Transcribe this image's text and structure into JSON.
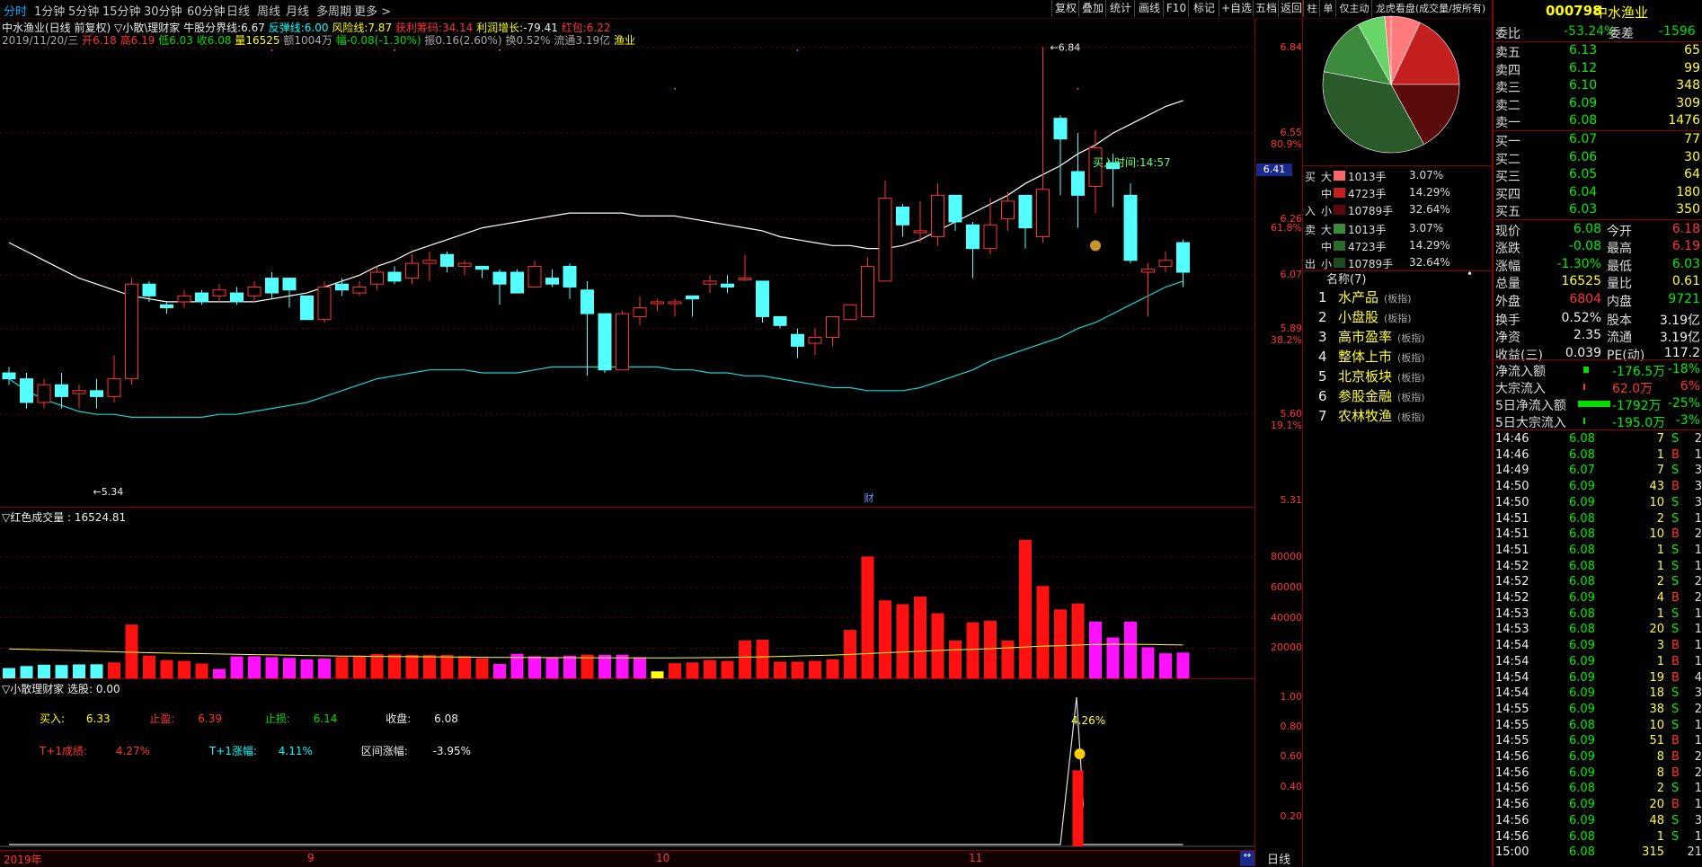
{
  "toolbar": {
    "periods": [
      "分时",
      "1分钟",
      "5分钟",
      "15分钟",
      "30分钟",
      "60分钟",
      "日线",
      "周线",
      "月线",
      "多周期",
      "更多 >"
    ],
    "actions": [
      "复权",
      "叠加",
      "统计",
      "画线",
      "F10",
      "标记",
      "+自选",
      "五档",
      "返回"
    ],
    "right_tabs": [
      "柱",
      "单",
      "仅主动",
      "龙虎看盘(成交量/按所有)"
    ]
  },
  "info1": {
    "stock": "中水渔业(日线 前复权)",
    "indicator": "▽小散\\理财家",
    "nk_label": "牛股分界线:",
    "nk_val": "6.67",
    "ft_label": "反弹线:",
    "ft_val": "6.00",
    "fx_label": "风险线:",
    "fx_val": "7.87",
    "hl_label": "获利筹码:",
    "hl_val": "34.14",
    "lr_label": "利润增长:",
    "lr_val": "-79.41",
    "hb_label": "红包:",
    "hb_val": "6.22"
  },
  "info2": {
    "date": "2019/11/20/三",
    "open_l": "开",
    "open": "6.18",
    "high_l": "高",
    "high": "6.19",
    "low_l": "低",
    "low": "6.03",
    "close_l": "收",
    "close": "6.08",
    "vol_l": "量",
    "vol": "16525",
    "amt": "额1004万",
    "chg": "幅-0.08(-1.30%)",
    "amp": "振0.16(2.60%)",
    "turn": "换0.52%",
    "float": "流通3.19亿",
    "sector": "渔业"
  },
  "main_chart": {
    "price_axis": [
      "6.84",
      "6.55",
      "6.26",
      "6.07",
      "5.89",
      "5.60",
      "5.31"
    ],
    "pct_axis": [
      "80.9%",
      "61.8%",
      "38.2%",
      "19.1%"
    ],
    "current_price_tag": "6.41",
    "high_marker": "6.84",
    "low_marker": "5.34",
    "buy_time": "买入时间:14:57",
    "cai_marker": "财"
  },
  "vol_panel": {
    "title": "▽红色成交量 : 16524.81",
    "axis": [
      "80000",
      "60000",
      "40000",
      "20000"
    ]
  },
  "sig_panel": {
    "title": "▽小散理财家  选股: 0.00",
    "buy_l": "买入:",
    "buy": "6.33",
    "tp_l": "止盈:",
    "tp": "6.39",
    "sl_l": "止损:",
    "sl": "6.14",
    "close_l": "收盘:",
    "close": "6.08",
    "t1_l": "T+1成绩:",
    "t1": "4.27%",
    "t1z_l": "T+1涨幅:",
    "t1z": "4.11%",
    "qj_l": "区间涨幅:",
    "qj": "-3.95%",
    "axis": [
      "1.00",
      "0.80",
      "0.60",
      "0.40",
      "0.20"
    ],
    "peak_label": "4.26%"
  },
  "date_axis": {
    "labels": [
      "2019年",
      "9",
      "10",
      "11"
    ],
    "period": "日线"
  },
  "flow_panel": {
    "rows": [
      {
        "side": "买",
        "size": "大",
        "vol": "1013手",
        "pct": "3.07%"
      },
      {
        "side": "",
        "size": "中",
        "vol": "4723手",
        "pct": "14.29%"
      },
      {
        "side": "入",
        "size": "小",
        "vol": "10789手",
        "pct": "32.64%"
      },
      {
        "side": "卖",
        "size": "大",
        "vol": "1013手",
        "pct": "3.07%"
      },
      {
        "side": "",
        "size": "中",
        "vol": "4723手",
        "pct": "14.29%"
      },
      {
        "side": "出",
        "size": "小",
        "vol": "10789手",
        "pct": "32.64%"
      }
    ]
  },
  "sectors": {
    "header": "名称(7)",
    "items": [
      {
        "idx": "1",
        "name": "水产品",
        "tag": "(板指)"
      },
      {
        "idx": "2",
        "name": "小盘股",
        "tag": "(板指)"
      },
      {
        "idx": "3",
        "name": "高市盈率",
        "tag": "(板指)"
      },
      {
        "idx": "4",
        "name": "整体上市",
        "tag": "(板指)"
      },
      {
        "idx": "5",
        "name": "北京板块",
        "tag": "(板指)"
      },
      {
        "idx": "6",
        "name": "参股金融",
        "tag": "(板指)"
      },
      {
        "idx": "7",
        "name": "农林牧渔",
        "tag": "(板指)"
      }
    ]
  },
  "quote": {
    "code": "000798",
    "name": "中水渔业",
    "weibi_l": "委比",
    "weibi": "-53.24%",
    "weicha_l": "委差",
    "weicha": "-1596",
    "asks": [
      {
        "label": "卖五",
        "price": "6.13",
        "vol": "65"
      },
      {
        "label": "卖四",
        "price": "6.12",
        "vol": "99"
      },
      {
        "label": "卖三",
        "price": "6.10",
        "vol": "348"
      },
      {
        "label": "卖二",
        "price": "6.09",
        "vol": "309"
      },
      {
        "label": "卖一",
        "price": "6.08",
        "vol": "1476"
      }
    ],
    "bids": [
      {
        "label": "买一",
        "price": "6.07",
        "vol": "77"
      },
      {
        "label": "买二",
        "price": "6.06",
        "vol": "30"
      },
      {
        "label": "买三",
        "price": "6.05",
        "vol": "64"
      },
      {
        "label": "买四",
        "price": "6.04",
        "vol": "180"
      },
      {
        "label": "买五",
        "price": "6.03",
        "vol": "350"
      }
    ],
    "stats": [
      {
        "l1": "现价",
        "v1": "6.08",
        "c1": "green",
        "l2": "今开",
        "v2": "6.18",
        "c2": "red"
      },
      {
        "l1": "涨跌",
        "v1": "-0.08",
        "c1": "green",
        "l2": "最高",
        "v2": "6.19",
        "c2": "red"
      },
      {
        "l1": "涨幅",
        "v1": "-1.30%",
        "c1": "green",
        "l2": "最低",
        "v2": "6.03",
        "c2": "green"
      },
      {
        "l1": "总量",
        "v1": "16525",
        "c1": "yellow",
        "l2": "量比",
        "v2": "0.61",
        "c2": "yellow"
      },
      {
        "l1": "外盘",
        "v1": "6804",
        "c1": "red",
        "l2": "内盘",
        "v2": "9721",
        "c2": "green"
      },
      {
        "l1": "换手",
        "v1": "0.52%",
        "c1": "white",
        "l2": "股本",
        "v2": "3.19亿",
        "c2": "white"
      },
      {
        "l1": "净资",
        "v1": "2.35",
        "c1": "white",
        "l2": "流通",
        "v2": "3.19亿",
        "c2": "white"
      },
      {
        "l1": "收益(三)",
        "v1": "0.039",
        "c1": "white",
        "l2": "PE(动)",
        "v2": "117.2",
        "c2": "white"
      }
    ],
    "flows": [
      {
        "label": "净流入额",
        "value": "-176.5万",
        "pct": "-18%"
      },
      {
        "label": "大宗流入",
        "value": "62.0万",
        "pct": "6%"
      },
      {
        "label": "5日净流入额",
        "value": "-1792万",
        "pct": "-25%"
      },
      {
        "label": "5日大宗流入",
        "value": "-195.0万",
        "pct": "-3%"
      }
    ]
  },
  "ticks": [
    {
      "t": "14:46",
      "p": "6.08",
      "v": "7",
      "d": "S",
      "n": "2"
    },
    {
      "t": "14:46",
      "p": "6.08",
      "v": "1",
      "d": "B",
      "n": "1"
    },
    {
      "t": "14:49",
      "p": "6.07",
      "v": "7",
      "d": "S",
      "n": "3"
    },
    {
      "t": "14:50",
      "p": "6.09",
      "v": "43",
      "d": "B",
      "n": "3"
    },
    {
      "t": "14:50",
      "p": "6.09",
      "v": "10",
      "d": "S",
      "n": "3"
    },
    {
      "t": "14:51",
      "p": "6.08",
      "v": "2",
      "d": "S",
      "n": "1"
    },
    {
      "t": "14:51",
      "p": "6.08",
      "v": "10",
      "d": "B",
      "n": "2"
    },
    {
      "t": "14:51",
      "p": "6.08",
      "v": "1",
      "d": "S",
      "n": "1"
    },
    {
      "t": "14:52",
      "p": "6.08",
      "v": "1",
      "d": "S",
      "n": "1"
    },
    {
      "t": "14:52",
      "p": "6.08",
      "v": "2",
      "d": "S",
      "n": "2"
    },
    {
      "t": "14:52",
      "p": "6.09",
      "v": "4",
      "d": "B",
      "n": "2"
    },
    {
      "t": "14:53",
      "p": "6.08",
      "v": "1",
      "d": "S",
      "n": "1"
    },
    {
      "t": "14:53",
      "p": "6.08",
      "v": "20",
      "d": "S",
      "n": "1"
    },
    {
      "t": "14:54",
      "p": "6.09",
      "v": "3",
      "d": "B",
      "n": "1"
    },
    {
      "t": "14:54",
      "p": "6.09",
      "v": "1",
      "d": "B",
      "n": "1"
    },
    {
      "t": "14:54",
      "p": "6.09",
      "v": "19",
      "d": "B",
      "n": "4"
    },
    {
      "t": "14:54",
      "p": "6.09",
      "v": "18",
      "d": "S",
      "n": "3"
    },
    {
      "t": "14:55",
      "p": "6.09",
      "v": "38",
      "d": "S",
      "n": "2"
    },
    {
      "t": "14:55",
      "p": "6.08",
      "v": "10",
      "d": "S",
      "n": "1"
    },
    {
      "t": "14:55",
      "p": "6.09",
      "v": "51",
      "d": "B",
      "n": "1"
    },
    {
      "t": "14:56",
      "p": "6.09",
      "v": "8",
      "d": "B",
      "n": "2"
    },
    {
      "t": "14:56",
      "p": "6.09",
      "v": "8",
      "d": "B",
      "n": "2"
    },
    {
      "t": "14:56",
      "p": "6.08",
      "v": "2",
      "d": "S",
      "n": "1"
    },
    {
      "t": "14:56",
      "p": "6.09",
      "v": "20",
      "d": "B",
      "n": "1"
    },
    {
      "t": "14:56",
      "p": "6.09",
      "v": "48",
      "d": "S",
      "n": "3"
    },
    {
      "t": "14:56",
      "p": "6.08",
      "v": "1",
      "d": "S",
      "n": "1"
    },
    {
      "t": "15:00",
      "p": "6.08",
      "v": "315",
      "d": "",
      "n": "21"
    }
  ],
  "candles": [
    [
      5.74,
      5.72,
      5.76,
      5.7
    ],
    [
      5.72,
      5.64,
      5.74,
      5.62
    ],
    [
      5.64,
      5.7,
      5.72,
      5.62
    ],
    [
      5.7,
      5.66,
      5.74,
      5.62
    ],
    [
      5.67,
      5.68,
      5.7,
      5.62
    ],
    [
      5.68,
      5.66,
      5.72,
      5.62
    ],
    [
      5.66,
      5.72,
      5.8,
      5.64
    ],
    [
      5.72,
      6.04,
      6.06,
      5.7
    ],
    [
      6.04,
      6.0,
      6.05,
      5.98
    ],
    [
      5.97,
      5.96,
      5.98,
      5.94
    ],
    [
      5.98,
      6.0,
      6.02,
      5.96
    ],
    [
      6.01,
      5.98,
      6.02,
      5.97
    ],
    [
      6.0,
      6.02,
      6.04,
      5.98
    ],
    [
      6.01,
      5.98,
      6.03,
      5.97
    ],
    [
      6.0,
      6.03,
      6.05,
      5.98
    ],
    [
      6.06,
      6.01,
      6.08,
      5.99
    ],
    [
      6.06,
      6.02,
      6.06,
      5.96
    ],
    [
      6.0,
      5.92,
      6.0,
      5.92
    ],
    [
      5.92,
      6.03,
      6.05,
      5.91
    ],
    [
      6.04,
      6.02,
      6.06,
      6.0
    ],
    [
      6.01,
      6.03,
      6.05,
      6.0
    ],
    [
      6.04,
      6.08,
      6.1,
      6.02
    ],
    [
      6.08,
      6.05,
      6.1,
      6.04
    ],
    [
      6.06,
      6.11,
      6.14,
      6.04
    ],
    [
      6.11,
      6.12,
      6.15,
      6.05
    ],
    [
      6.14,
      6.1,
      6.15,
      6.08
    ],
    [
      6.1,
      6.11,
      6.12,
      6.07
    ],
    [
      6.1,
      6.09,
      6.1,
      6.06
    ],
    [
      6.08,
      6.04,
      6.09,
      5.97
    ],
    [
      6.08,
      6.01,
      6.09,
      6.01
    ],
    [
      6.03,
      6.1,
      6.12,
      6.03
    ],
    [
      6.06,
      6.04,
      6.09,
      6.03
    ],
    [
      6.1,
      6.03,
      6.11,
      5.99
    ],
    [
      6.02,
      5.94,
      6.05,
      5.73
    ],
    [
      5.94,
      5.75,
      5.94,
      5.74
    ],
    [
      5.75,
      5.94,
      5.95,
      5.75
    ],
    [
      5.93,
      5.96,
      6.0,
      5.9
    ],
    [
      5.98,
      5.98,
      5.99,
      5.95
    ],
    [
      5.98,
      5.98,
      5.99,
      5.93
    ],
    [
      6.0,
      5.99,
      6.0,
      5.93
    ],
    [
      6.04,
      6.05,
      6.07,
      6.01
    ],
    [
      6.04,
      6.03,
      6.07,
      6.01
    ],
    [
      6.06,
      6.06,
      6.14,
      6.05
    ],
    [
      6.05,
      5.93,
      6.05,
      5.91
    ],
    [
      5.93,
      5.9,
      5.93,
      5.89
    ],
    [
      5.87,
      5.83,
      5.89,
      5.79
    ],
    [
      5.84,
      5.86,
      5.89,
      5.8
    ],
    [
      5.86,
      5.93,
      5.93,
      5.83
    ],
    [
      5.92,
      5.97,
      5.97,
      5.93
    ],
    [
      5.93,
      6.1,
      6.13,
      5.93
    ],
    [
      6.05,
      6.33,
      6.39,
      6.05
    ],
    [
      6.3,
      6.24,
      6.31,
      6.2
    ],
    [
      6.22,
      6.22,
      6.32,
      6.18
    ],
    [
      6.2,
      6.34,
      6.38,
      6.17
    ],
    [
      6.34,
      6.25,
      6.34,
      6.22
    ],
    [
      6.24,
      6.16,
      6.25,
      6.06
    ],
    [
      6.16,
      6.24,
      6.33,
      6.14
    ],
    [
      6.26,
      6.32,
      6.35,
      6.22
    ],
    [
      6.34,
      6.23,
      6.34,
      6.16
    ],
    [
      6.2,
      6.36,
      6.84,
      6.18
    ],
    [
      6.6,
      6.53,
      6.61,
      6.34
    ],
    [
      6.42,
      6.34,
      6.55,
      6.23
    ],
    [
      6.37,
      6.5,
      6.56,
      6.28
    ],
    [
      6.45,
      6.43,
      6.48,
      6.3
    ],
    [
      6.34,
      6.12,
      6.38,
      6.11
    ],
    [
      6.08,
      6.09,
      6.11,
      5.93
    ],
    [
      6.1,
      6.12,
      6.15,
      6.08
    ],
    [
      6.18,
      6.08,
      6.19,
      6.03
    ]
  ],
  "volumes": [
    [
      6800,
      "c"
    ],
    [
      8100,
      "c"
    ],
    [
      9000,
      "c"
    ],
    [
      8800,
      "c"
    ],
    [
      9200,
      "c"
    ],
    [
      9300,
      "c"
    ],
    [
      10500,
      "r"
    ],
    [
      35500,
      "r"
    ],
    [
      15000,
      "r"
    ],
    [
      12000,
      "r"
    ],
    [
      11500,
      "r"
    ],
    [
      9800,
      "r"
    ],
    [
      6200,
      "m"
    ],
    [
      14500,
      "m"
    ],
    [
      14600,
      "m"
    ],
    [
      14000,
      "m"
    ],
    [
      13500,
      "m"
    ],
    [
      12500,
      "m"
    ],
    [
      13000,
      "m"
    ],
    [
      14000,
      "r"
    ],
    [
      15000,
      "r"
    ],
    [
      16000,
      "r"
    ],
    [
      15800,
      "r"
    ],
    [
      15500,
      "r"
    ],
    [
      15400,
      "r"
    ],
    [
      15400,
      "r"
    ],
    [
      14700,
      "r"
    ],
    [
      13200,
      "r"
    ],
    [
      9500,
      "m"
    ],
    [
      16200,
      "m"
    ],
    [
      14600,
      "m"
    ],
    [
      13800,
      "m"
    ],
    [
      15000,
      "m"
    ],
    [
      15700,
      "r"
    ],
    [
      15500,
      "m"
    ],
    [
      15600,
      "m"
    ],
    [
      14000,
      "m"
    ],
    [
      4600,
      "y"
    ],
    [
      10000,
      "r"
    ],
    [
      10500,
      "r"
    ],
    [
      12000,
      "r"
    ],
    [
      11500,
      "r"
    ],
    [
      25000,
      "r"
    ],
    [
      25500,
      "r"
    ],
    [
      11000,
      "r"
    ],
    [
      11000,
      "r"
    ],
    [
      11500,
      "r"
    ],
    [
      12500,
      "r"
    ],
    [
      32000,
      "r"
    ],
    [
      80500,
      "r"
    ],
    [
      51500,
      "r"
    ],
    [
      49000,
      "r"
    ],
    [
      54000,
      "r"
    ],
    [
      43000,
      "r"
    ],
    [
      25000,
      "r"
    ],
    [
      37000,
      "r"
    ],
    [
      38000,
      "r"
    ],
    [
      25000,
      "r"
    ],
    [
      91500,
      "r"
    ],
    [
      61000,
      "r"
    ],
    [
      45500,
      "r"
    ],
    [
      49500,
      "r"
    ],
    [
      37500,
      "m"
    ],
    [
      27000,
      "m"
    ],
    [
      37500,
      "m"
    ],
    [
      20500,
      "m"
    ],
    [
      16500,
      "m"
    ],
    [
      17000,
      "m"
    ]
  ],
  "upper_band": [
    6.18,
    6.15,
    6.12,
    6.09,
    6.06,
    6.04,
    6.02,
    6.0,
    5.99,
    5.98,
    5.98,
    5.98,
    5.98,
    5.98,
    5.98,
    5.99,
    6.0,
    6.01,
    6.03,
    6.05,
    6.07,
    6.1,
    6.12,
    6.15,
    6.17,
    6.19,
    6.21,
    6.23,
    6.24,
    6.25,
    6.26,
    6.27,
    6.28,
    6.28,
    6.28,
    6.28,
    6.27,
    6.27,
    6.27,
    6.26,
    6.25,
    6.24,
    6.23,
    6.22,
    6.2,
    6.19,
    6.18,
    6.17,
    6.17,
    6.16,
    6.16,
    6.17,
    6.19,
    6.22,
    6.25,
    6.28,
    6.31,
    6.34,
    6.38,
    6.41,
    6.44,
    6.48,
    6.51,
    6.55,
    6.58,
    6.61,
    6.64,
    6.66
  ],
  "lower_band": [
    5.72,
    5.68,
    5.65,
    5.63,
    5.61,
    5.6,
    5.6,
    5.59,
    5.59,
    5.59,
    5.59,
    5.59,
    5.6,
    5.6,
    5.61,
    5.62,
    5.63,
    5.64,
    5.66,
    5.68,
    5.7,
    5.72,
    5.73,
    5.74,
    5.75,
    5.75,
    5.75,
    5.74,
    5.74,
    5.74,
    5.75,
    5.76,
    5.76,
    5.76,
    5.76,
    5.76,
    5.76,
    5.76,
    5.75,
    5.75,
    5.74,
    5.74,
    5.73,
    5.73,
    5.72,
    5.71,
    5.7,
    5.69,
    5.69,
    5.68,
    5.68,
    5.68,
    5.69,
    5.71,
    5.73,
    5.75,
    5.78,
    5.8,
    5.82,
    5.84,
    5.86,
    5.89,
    5.91,
    5.94,
    5.97,
    6.0,
    6.03,
    6.05
  ],
  "vol_ma": [
    19500,
    19200,
    18900,
    18500,
    18200,
    17900,
    17500,
    17200,
    16900,
    16700,
    16500,
    16300,
    16100,
    15900,
    15700,
    15500,
    15300,
    15100,
    14900,
    14700,
    14600,
    14500,
    14400,
    14300,
    14200,
    14100,
    14000,
    13900,
    13800,
    13800,
    13700,
    13700,
    13600,
    13600,
    13600,
    13500,
    13500,
    13500,
    13500,
    13600,
    13700,
    13800,
    14000,
    14200,
    14500,
    14800,
    15100,
    15400,
    15800,
    16300,
    16900,
    17400,
    17900,
    18400,
    18800,
    19200,
    19600,
    20100,
    20700,
    21200,
    21600,
    22000,
    22300,
    22500,
    22500,
    22400,
    22200,
    22000
  ],
  "colors": {
    "up": "#ff3333",
    "down": "#54ffff",
    "border": "#8a0000",
    "ma": "#ffffff",
    "lower": "#19d6d6"
  }
}
